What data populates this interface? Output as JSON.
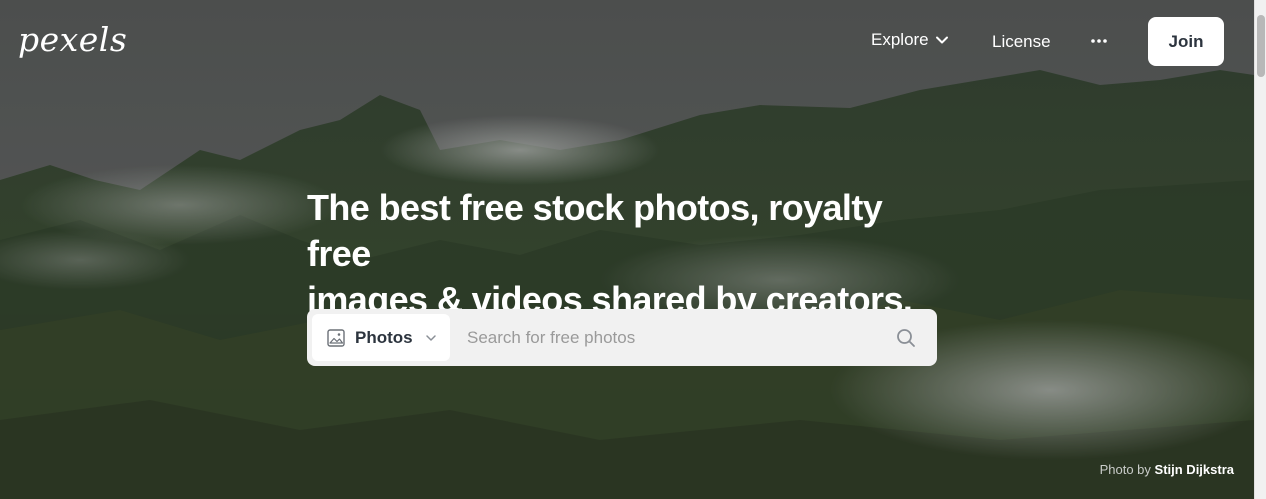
{
  "header": {
    "logo": "pexels",
    "nav": {
      "explore": "Explore",
      "license": "License"
    },
    "join": "Join"
  },
  "hero": {
    "headline_line1": "The best free stock photos, royalty free",
    "headline_line2": "images & videos shared by creators."
  },
  "search": {
    "type_label": "Photos",
    "placeholder": "Search for free photos",
    "value": ""
  },
  "credit": {
    "prefix": "Photo by",
    "author": "Stijn Dijkstra"
  },
  "icons": {
    "explore_chevron": "chevron-down-icon",
    "more": "more-dots-icon",
    "type": "image-icon",
    "type_chevron": "chevron-down-icon",
    "search": "search-icon"
  },
  "colors": {
    "text_dark": "#2c343e",
    "white": "#ffffff",
    "search_bg": "#f1f1f1"
  }
}
